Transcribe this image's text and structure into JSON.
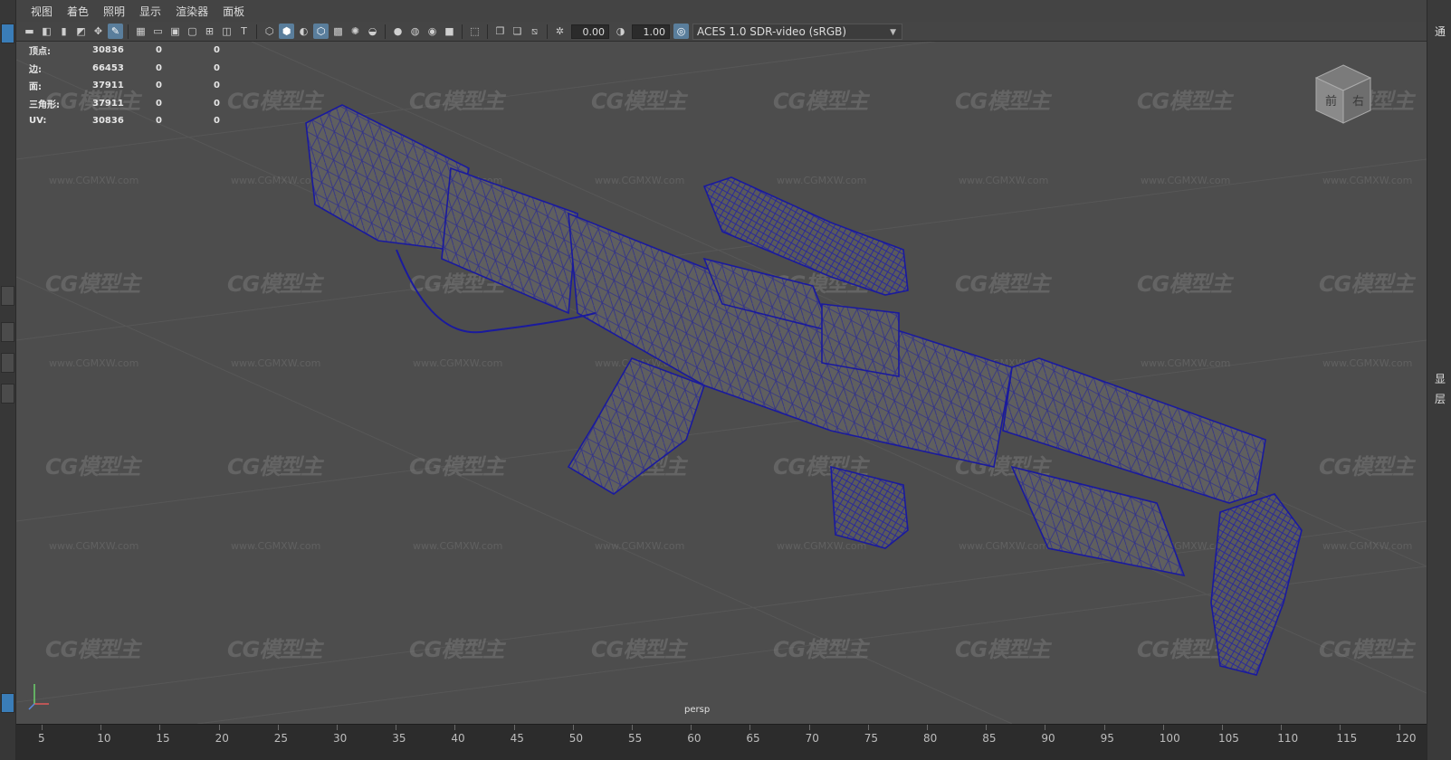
{
  "menu": [
    "视图",
    "着色",
    "照明",
    "显示",
    "渲染器",
    "面板"
  ],
  "toolbar": {
    "exposure_value": "0.00",
    "gamma_value": "1.00",
    "color_space": "ACES 1.0 SDR-video (sRGB)"
  },
  "hud": {
    "rows": [
      {
        "label": "顶点:",
        "v1": "30836",
        "v2": "0",
        "v3": "0"
      },
      {
        "label": "边:",
        "v1": "66453",
        "v2": "0",
        "v3": "0"
      },
      {
        "label": "面:",
        "v1": "37911",
        "v2": "0",
        "v3": "0"
      },
      {
        "label": "三角形:",
        "v1": "37911",
        "v2": "0",
        "v3": "0"
      },
      {
        "label": "UV:",
        "v1": "30836",
        "v2": "0",
        "v3": "0"
      }
    ]
  },
  "viewport": {
    "camera_label": "persp",
    "viewcube_front": "前",
    "viewcube_right": "右"
  },
  "watermark": {
    "logo": "CG模型主",
    "url": "www.CGMXW.com"
  },
  "right_strip": {
    "top_char": "通",
    "mid_char_1": "显",
    "mid_char_2": "层"
  },
  "ruler": {
    "labels": [
      "5",
      "10",
      "15",
      "20",
      "25",
      "30",
      "35",
      "40",
      "45",
      "50",
      "55",
      "60",
      "65",
      "70",
      "75",
      "80",
      "85",
      "90",
      "95",
      "100",
      "105",
      "110",
      "115",
      "120"
    ]
  },
  "colors": {
    "wireframe": "#1a1a9e",
    "mesh_fill": "#5e5e5e",
    "viewport_bg": "#4d4d4d"
  }
}
